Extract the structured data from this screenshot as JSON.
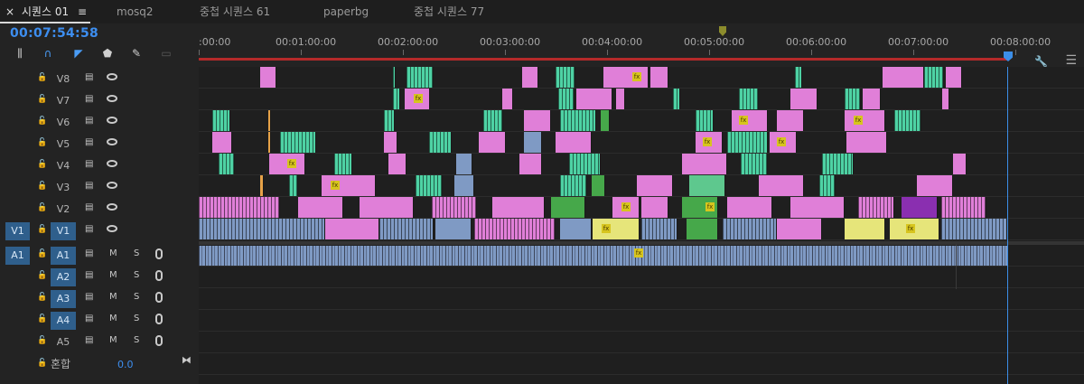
{
  "tabs": [
    {
      "label": "시퀀스 01",
      "active": true
    },
    {
      "label": "mosq2",
      "active": false
    },
    {
      "label": "중첩 시퀀스 61",
      "active": false
    },
    {
      "label": "paperbg",
      "active": false
    },
    {
      "label": "중첩 시퀀스 77",
      "active": false
    }
  ],
  "tab_close_glyph": "×",
  "tab_menu_glyph": "≡",
  "timecode": "00:07:54:58",
  "toolbar": [
    "snap-icon",
    "linked-selection-icon",
    "add-marker-icon",
    "marker-icon",
    "settings-wrench-icon",
    "captions-icon"
  ],
  "ruler": {
    "labels": [
      ":00:00",
      "00:01:00:00",
      "00:02:00:00",
      "00:03:00:00",
      "00:04:00:00",
      "00:05:00:00",
      "00:06:00:00",
      "00:07:00:00",
      "00:08:00:00"
    ]
  },
  "video_tracks": [
    {
      "name": "V8",
      "source": ""
    },
    {
      "name": "V7",
      "source": ""
    },
    {
      "name": "V6",
      "source": ""
    },
    {
      "name": "V5",
      "source": ""
    },
    {
      "name": "V4",
      "source": ""
    },
    {
      "name": "V3",
      "source": ""
    },
    {
      "name": "V2",
      "source": ""
    },
    {
      "name": "V1",
      "source": "V1"
    }
  ],
  "audio_tracks": [
    {
      "name": "A1",
      "source": "A1"
    },
    {
      "name": "A2",
      "source": ""
    },
    {
      "name": "A3",
      "source": ""
    },
    {
      "name": "A4",
      "source": ""
    },
    {
      "name": "A5",
      "source": ""
    }
  ],
  "audio_buttons": {
    "mute": "M",
    "solo": "S"
  },
  "mix": {
    "label": "혼합",
    "value": "0.0"
  },
  "fx_label": "fx",
  "colors": {
    "pink": "#e07fd8",
    "green": "#5ec88e",
    "teal": "#4ed2a4",
    "blue": "#7f9ac4",
    "yellow": "#e6e57a",
    "lime": "#46a84a",
    "purple": "#8a2fb0",
    "orange": "#e6a248",
    "accent": "#3d8ef0"
  }
}
